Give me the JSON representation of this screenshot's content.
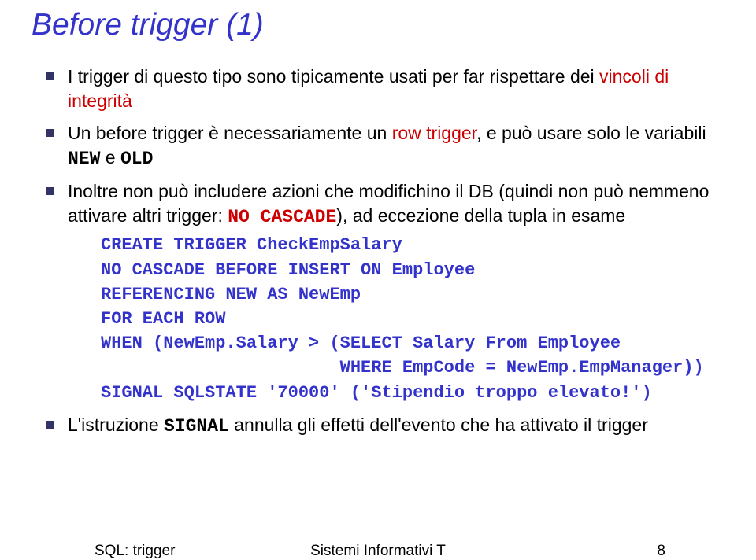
{
  "title": "Before trigger (1)",
  "bullets": {
    "b1_a": "I trigger di questo tipo sono tipicamente usati per far rispettare dei ",
    "b1_b": "vincoli di integrità",
    "b2_a": "Un before trigger è necessariamente un ",
    "b2_b": "row trigger",
    "b2_c": ", e può usare solo le variabili ",
    "b2_d": "NEW",
    "b2_e": " e ",
    "b2_f": "OLD",
    "b3_a": "Inoltre non può includere azioni che modifichino il DB (quindi non può nemmeno attivare altri trigger: ",
    "b3_b": "NO CASCADE",
    "b3_c": "), ad eccezione della tupla in esame",
    "b4_a": "L'istruzione ",
    "b4_b": "SIGNAL",
    "b4_c": " annulla gli effetti dell'evento che ha attivato il trigger"
  },
  "code": {
    "l1": "CREATE TRIGGER CheckEmpSalary",
    "l2": "NO CASCADE BEFORE INSERT ON Employee",
    "l3": "REFERENCING NEW AS NewEmp",
    "l4": "FOR EACH ROW",
    "l5": "WHEN (NewEmp.Salary > (SELECT Salary From Employee",
    "l6": "                       WHERE EmpCode = NewEmp.EmpManager))",
    "l7": "SIGNAL SQLSTATE '70000' ('Stipendio troppo elevato!')"
  },
  "footer": {
    "left": "SQL: trigger",
    "center": "Sistemi Informativi T",
    "right": "8"
  }
}
